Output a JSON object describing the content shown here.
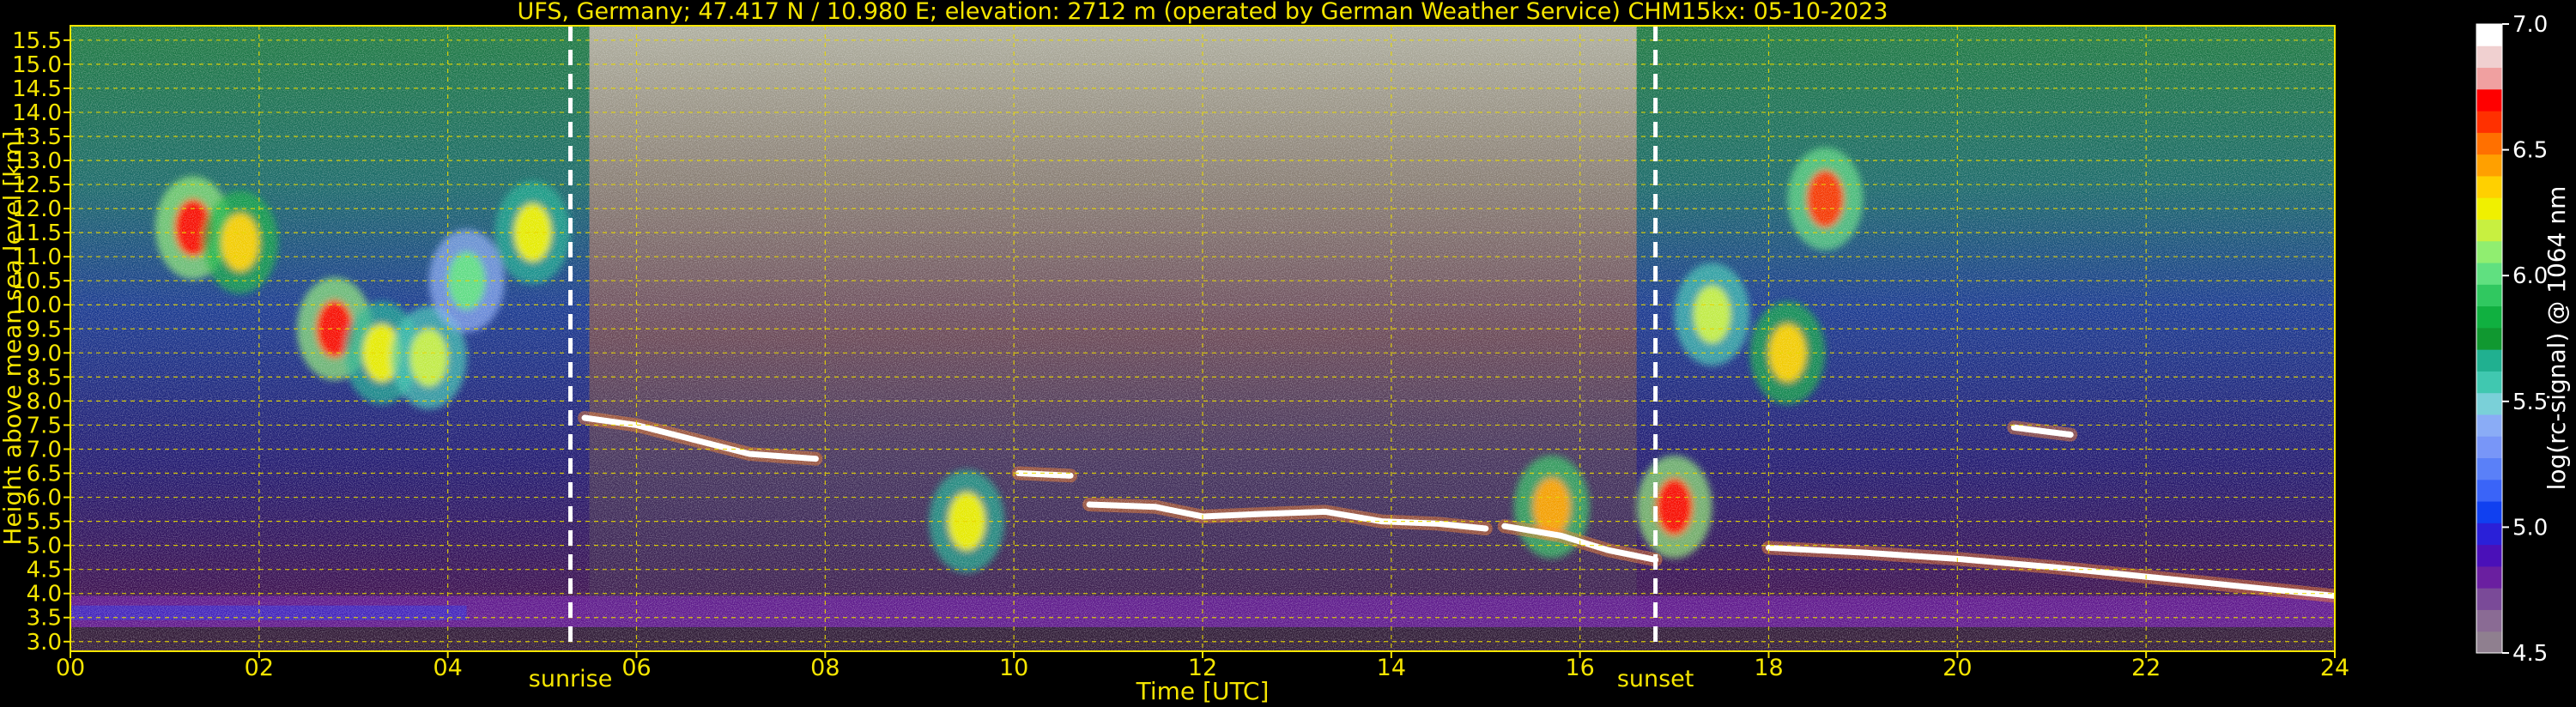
{
  "chart_data": {
    "type": "heatmap",
    "title": "UFS, Germany; 47.417 N / 10.980 E; elevation: 2712 m  (operated by German Weather Service)    CHM15kx: 05-10-2023",
    "xlabel": "Time [UTC]",
    "ylabel": "Height above mean sea level [km]",
    "xlim": [
      0,
      24
    ],
    "ylim": [
      2.8,
      15.8
    ],
    "x_ticks": [
      "00",
      "02",
      "04",
      "06",
      "08",
      "10",
      "12",
      "14",
      "16",
      "18",
      "20",
      "22",
      "24"
    ],
    "y_ticks": [
      "3.0",
      "3.5",
      "4.0",
      "4.5",
      "5.0",
      "5.5",
      "6.0",
      "6.5",
      "7.0",
      "7.5",
      "8.0",
      "8.5",
      "9.0",
      "9.5",
      "10.0",
      "10.5",
      "11.0",
      "11.5",
      "12.0",
      "12.5",
      "13.0",
      "13.5",
      "14.0",
      "14.5",
      "15.0",
      "15.5"
    ],
    "grid": true,
    "sunrise": {
      "label": "sunrise",
      "time": 5.3
    },
    "sunset": {
      "label": "sunset",
      "time": 16.8
    },
    "colorbar": {
      "label": "log(rc-signal) @ 1064 nm",
      "min": 4.5,
      "max": 7.0,
      "ticks": [
        "4.5",
        "5.0",
        "5.5",
        "6.0",
        "6.5",
        "7.0"
      ],
      "colors": [
        "#8f7f8f",
        "#8a6b94",
        "#7a4a98",
        "#6a1fa0",
        "#4a10b8",
        "#2a20d8",
        "#1040f0",
        "#3a64f8",
        "#5a80f8",
        "#7896f8",
        "#8aacf6",
        "#7ad0d8",
        "#40c8b0",
        "#20b090",
        "#109830",
        "#10b040",
        "#30c860",
        "#60e080",
        "#90ee70",
        "#c8f040",
        "#f0f000",
        "#ffd000",
        "#ffa000",
        "#ff7000",
        "#ff3000",
        "#ff0000",
        "#f0a0a0",
        "#f0d0d0",
        "#ffffff"
      ]
    },
    "cloud_base_segments": [
      {
        "name": "mid-layer-1",
        "x": [
          5.45,
          6.0,
          6.6,
          7.2,
          7.9
        ],
        "y": [
          7.65,
          7.5,
          7.2,
          6.9,
          6.8
        ]
      },
      {
        "name": "mid-layer-2",
        "x": [
          10.05,
          10.6
        ],
        "y": [
          6.5,
          6.45
        ]
      },
      {
        "name": "mid-layer-3",
        "x": [
          10.8,
          11.5,
          12.0,
          12.6,
          13.3,
          13.9,
          14.5,
          15.0
        ],
        "y": [
          5.85,
          5.8,
          5.6,
          5.65,
          5.7,
          5.5,
          5.45,
          5.35
        ]
      },
      {
        "name": "low-layer",
        "x": [
          15.2,
          15.8,
          16.3,
          16.8
        ],
        "y": [
          5.4,
          5.2,
          4.9,
          4.7
        ]
      },
      {
        "name": "evening-boundary",
        "x": [
          18.0,
          19.0,
          20.0,
          21.0,
          22.0,
          23.0,
          24.0
        ],
        "y": [
          4.95,
          4.85,
          4.72,
          4.55,
          4.35,
          4.15,
          3.95
        ]
      },
      {
        "name": "small-cloud",
        "x": [
          20.6,
          21.2
        ],
        "y": [
          7.45,
          7.3
        ]
      }
    ],
    "cirrus_blobs": [
      {
        "x": 1.3,
        "y": 11.6,
        "v": 6.7
      },
      {
        "x": 1.8,
        "y": 11.3,
        "v": 6.4
      },
      {
        "x": 2.8,
        "y": 9.5,
        "v": 6.7
      },
      {
        "x": 3.3,
        "y": 9.0,
        "v": 6.3
      },
      {
        "x": 3.8,
        "y": 8.9,
        "v": 6.2
      },
      {
        "x": 4.2,
        "y": 10.5,
        "v": 6.0
      },
      {
        "x": 4.9,
        "y": 11.5,
        "v": 6.3
      },
      {
        "x": 17.4,
        "y": 9.8,
        "v": 6.2
      },
      {
        "x": 18.2,
        "y": 9.0,
        "v": 6.4
      },
      {
        "x": 18.6,
        "y": 12.2,
        "v": 6.6
      },
      {
        "x": 17.0,
        "y": 5.8,
        "v": 6.7
      },
      {
        "x": 15.7,
        "y": 5.8,
        "v": 6.5
      },
      {
        "x": 9.5,
        "y": 5.5,
        "v": 6.3
      }
    ]
  }
}
